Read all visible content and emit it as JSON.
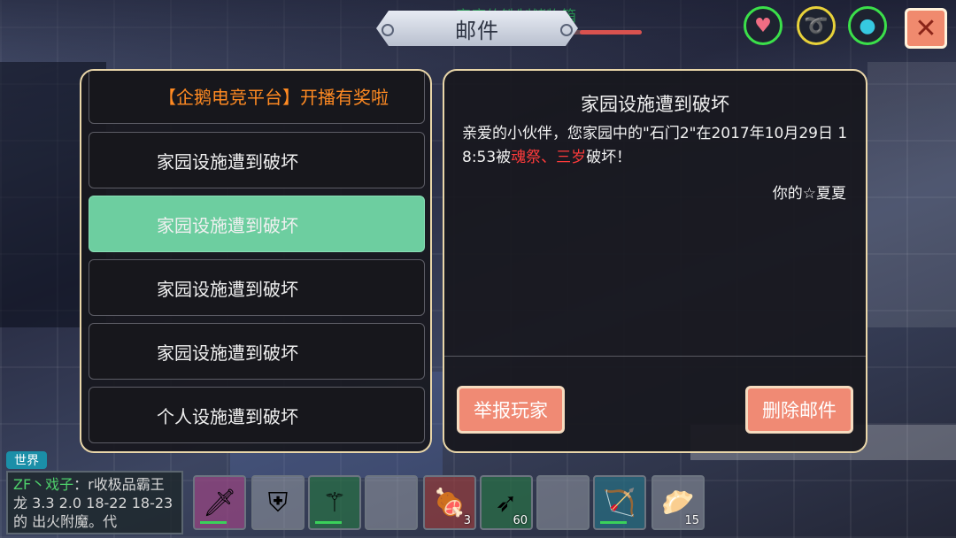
{
  "header": {
    "ghost_text": "家庭的铁制储物箱",
    "title": "邮件",
    "stats": {
      "heart_icon": "heart-icon",
      "food_icon": "food-icon",
      "water_icon": "water-drop-icon"
    },
    "close_icon": "close-icon",
    "health_fraction": 0.26
  },
  "mail_list": {
    "items": [
      {
        "label": "【企鹅电竞平台】开播有奖啦",
        "state": "promo"
      },
      {
        "label": "家园设施遭到破坏",
        "state": "normal"
      },
      {
        "label": "家园设施遭到破坏",
        "state": "selected"
      },
      {
        "label": "家园设施遭到破坏",
        "state": "normal"
      },
      {
        "label": "家园设施遭到破坏",
        "state": "normal"
      },
      {
        "label": "个人设施遭到破坏",
        "state": "normal"
      }
    ]
  },
  "detail": {
    "title": "家园设施遭到破坏",
    "body_prefix": "亲爱的小伙伴，您家园中的\"石门2\"在2017年10月29日 18:53被",
    "body_attacker": "魂祭、三岁",
    "body_suffix": "破坏！",
    "signature": "你的☆夏夏",
    "report_label": "举报玩家",
    "delete_label": "删除邮件"
  },
  "chat": {
    "channel": "世界",
    "sender": "ZF丶戏子",
    "message": "：r收极品霸王龙 3.3 2.0 18-22 18-23的 出火附魔。代"
  },
  "hotbar": [
    {
      "icon": "sword-icon",
      "count": ""
    },
    {
      "icon": "shield-icon",
      "count": ""
    },
    {
      "icon": "staff-icon",
      "count": ""
    },
    {
      "icon": "empty-slot",
      "count": ""
    },
    {
      "icon": "meat-icon",
      "count": "3"
    },
    {
      "icon": "arrow-icon",
      "count": "60"
    },
    {
      "icon": "empty-slot",
      "count": ""
    },
    {
      "icon": "bow-icon",
      "count": ""
    },
    {
      "icon": "bun-icon",
      "count": "15"
    }
  ]
}
